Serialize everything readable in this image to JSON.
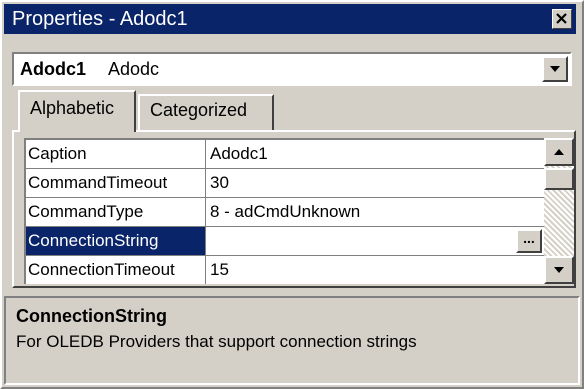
{
  "window": {
    "title": "Properties - Adodc1"
  },
  "object": {
    "name": "Adodc1",
    "type": "Adodc"
  },
  "tabs": [
    {
      "label": "Alphabetic",
      "active": true
    },
    {
      "label": "Categorized",
      "active": false
    }
  ],
  "properties": [
    {
      "name": "Caption",
      "value": "Adodc1"
    },
    {
      "name": "CommandTimeout",
      "value": "30"
    },
    {
      "name": "CommandType",
      "value": "8 - adCmdUnknown"
    },
    {
      "name": "ConnectionString",
      "value": "",
      "selected": true
    },
    {
      "name": "ConnectionTimeout",
      "value": "15"
    }
  ],
  "ellipsis_label": "...",
  "description": {
    "title": "ConnectionString",
    "text": "For OLEDB Providers that support connection strings"
  },
  "colors": {
    "selection": "#0a246a",
    "face": "#d4d0c8"
  },
  "icons": [
    "close-icon",
    "chevron-down-icon",
    "scroll-up-icon",
    "scroll-down-icon"
  ]
}
